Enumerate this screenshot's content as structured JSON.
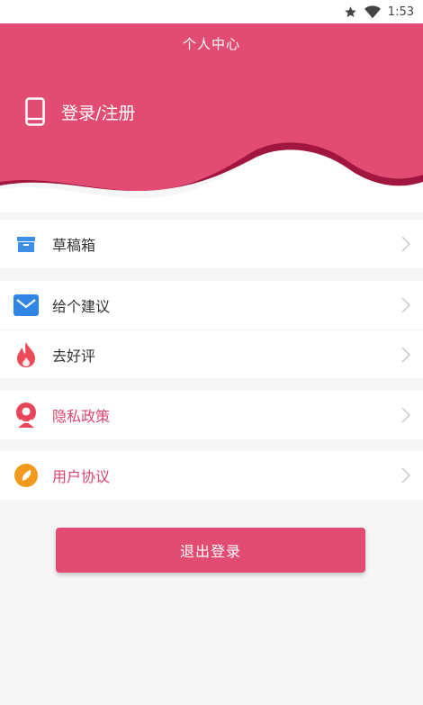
{
  "status_bar": {
    "time": "1:53"
  },
  "header": {
    "title": "个人中心",
    "login_label": "登录/注册"
  },
  "menu": {
    "group1": [
      {
        "label": "草稿箱"
      }
    ],
    "group2": [
      {
        "label": "给个建议"
      },
      {
        "label": "去好评"
      }
    ],
    "group3": [
      {
        "label": "隐私政策"
      }
    ],
    "group4": [
      {
        "label": "用户协议"
      }
    ]
  },
  "logout": {
    "label": "退出登录"
  },
  "colors": {
    "brand": "#e24b72",
    "wave_dark": "#a0163f",
    "drafts_icon": "#3d8ee6",
    "feedback_icon": "#2f86e4",
    "rate_icon": "#ec4a57",
    "privacy_icon": "#e8445a",
    "agreement_icon": "#f39a1e"
  }
}
